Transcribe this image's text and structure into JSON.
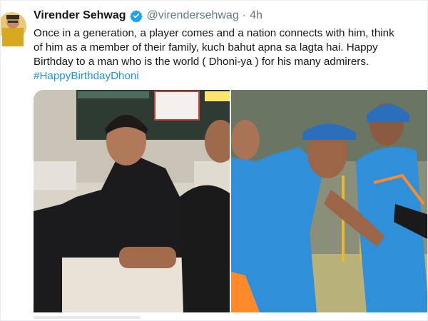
{
  "tweet": {
    "display_name": "Virender Sehwag",
    "handle": "@virendersehwag",
    "separator": "·",
    "timestamp": "4h",
    "text_lines": [
      "Once in a generation, a player comes and a nation  connects with him, think",
      "of him as a member of their family, kuch bahut apna sa lagta hai. Happy",
      "Birthday to a man who is the world ( Dhoni-ya ) for his many admirers."
    ],
    "hashtag": "#HappyBirthdayDhoni"
  },
  "colors": {
    "verified_badge": "#1da1f2",
    "hashtag": "#1b95e0",
    "secondary_text": "#657786",
    "jersey_blue": "#2f8fd8",
    "jersey_orange": "#ff8a2a"
  },
  "icons": {
    "verified": "verified-check-icon"
  }
}
